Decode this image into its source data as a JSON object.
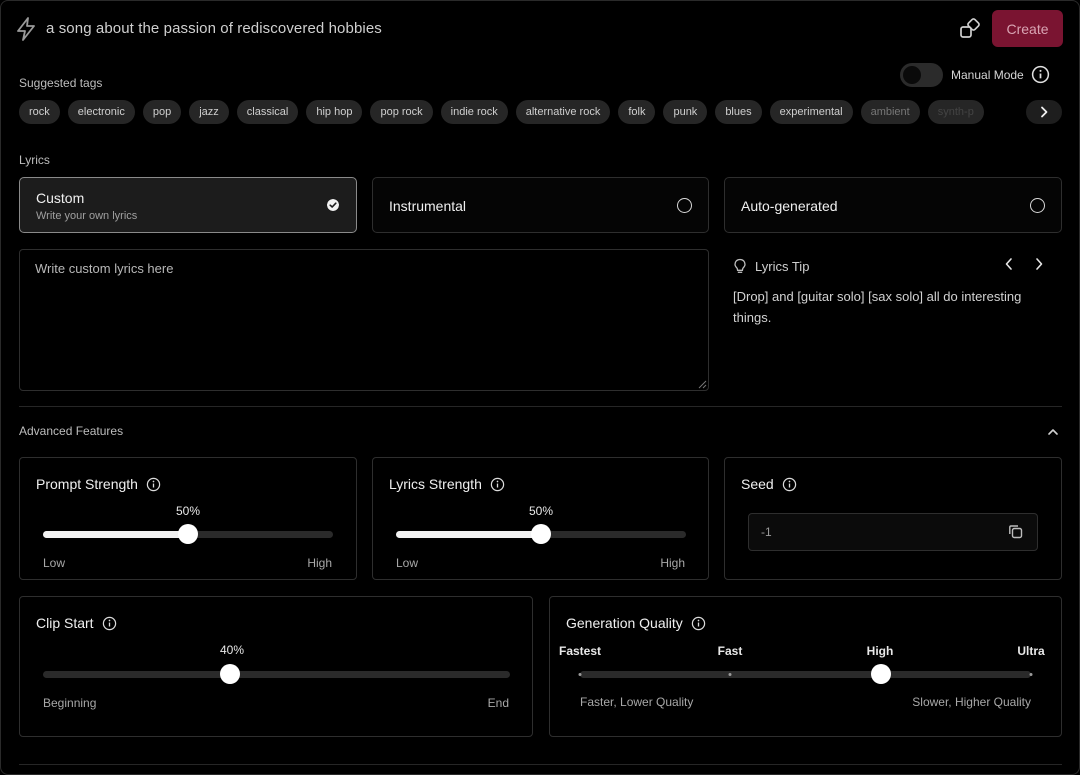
{
  "prompt": {
    "text": "a song about the passion of rediscovered hobbies"
  },
  "header": {
    "create_label": "Create"
  },
  "suggested": {
    "label": "Suggested tags",
    "tags": [
      "rock",
      "electronic",
      "pop",
      "jazz",
      "classical",
      "hip hop",
      "pop rock",
      "indie rock",
      "alternative rock",
      "folk",
      "punk",
      "blues",
      "experimental",
      "ambient",
      "synth-p"
    ]
  },
  "manual_mode": {
    "label": "Manual Mode",
    "enabled": false
  },
  "lyrics": {
    "label": "Lyrics",
    "options": [
      {
        "title": "Custom",
        "subtitle": "Write your own lyrics",
        "selected": true
      },
      {
        "title": "Instrumental",
        "subtitle": "",
        "selected": false
      },
      {
        "title": "Auto-generated",
        "subtitle": "",
        "selected": false
      }
    ],
    "placeholder": "Write custom lyrics here",
    "tip": {
      "title": "Lyrics Tip",
      "text": "[Drop] and [guitar solo] [sax solo] all do interesting things."
    }
  },
  "advanced": {
    "label": "Advanced Features",
    "prompt_strength": {
      "title": "Prompt Strength",
      "value": 50,
      "value_label": "50%",
      "low": "Low",
      "high": "High"
    },
    "lyrics_strength": {
      "title": "Lyrics Strength",
      "value": 50,
      "value_label": "50%",
      "low": "Low",
      "high": "High"
    },
    "seed": {
      "title": "Seed",
      "value": "-1"
    },
    "clip_start": {
      "title": "Clip Start",
      "value": 40,
      "value_label": "40%",
      "low": "Beginning",
      "high": "End"
    },
    "generation_quality": {
      "title": "Generation Quality",
      "levels": [
        "Fastest",
        "Fast",
        "High",
        "Ultra"
      ],
      "selected_index": 2,
      "low": "Faster, Lower Quality",
      "high": "Slower, Higher Quality"
    }
  },
  "colors": {
    "accent_create": "#7a1431",
    "background": "#000000"
  }
}
